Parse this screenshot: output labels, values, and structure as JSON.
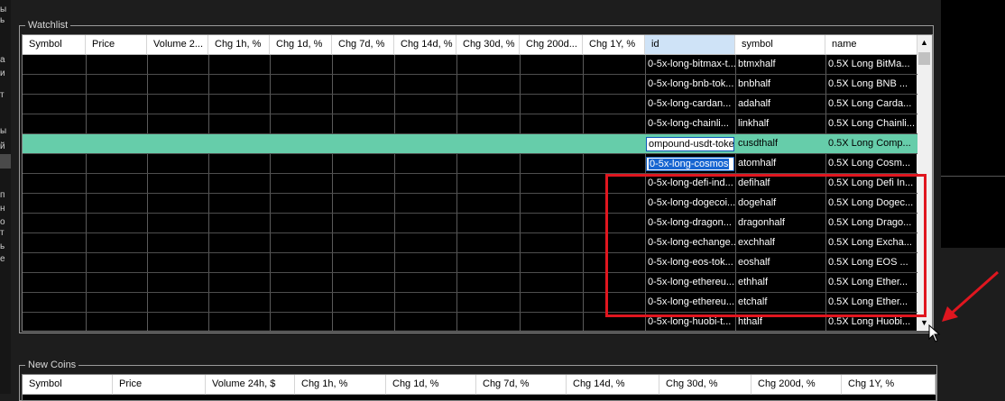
{
  "left_strip": [
    "ы",
    "ь",
    "а",
    "и",
    "т",
    "ы",
    "й",
    "п",
    "н",
    "о",
    "т",
    "ь",
    "е"
  ],
  "watchlist": {
    "title": "Watchlist",
    "columns": [
      "Symbol",
      "Price",
      "Volume 2...",
      "Chg 1h, %",
      "Chg 1d, %",
      "Chg 7d, %",
      "Chg 14d, %",
      "Chg 30d, %",
      "Chg 200d...",
      "Chg 1Y, %",
      "id",
      "symbol",
      "name"
    ],
    "rows": [
      {
        "id": "0-5x-long-bitmax-t...",
        "symbol": "btmxhalf",
        "name": "0.5X Long BitMa..."
      },
      {
        "id": "0-5x-long-bnb-tok...",
        "symbol": "bnbhalf",
        "name": "0.5X Long BNB ..."
      },
      {
        "id": "0-5x-long-cardan...",
        "symbol": "adahalf",
        "name": "0.5X Long Carda..."
      },
      {
        "id": "0-5x-long-chainli...",
        "symbol": "linkhalf",
        "name": "0.5X Long Chainli..."
      },
      {
        "id_edit": "ompound-usdt-token",
        "symbol": "cusdthalf",
        "name": "0.5X Long Comp...",
        "selected": true
      },
      {
        "id_edit_hl": "0-5x-long-cosmos",
        "symbol": "atomhalf",
        "name": "0.5X Long Cosm..."
      },
      {
        "id": "0-5x-long-defi-ind...",
        "symbol": "defihalf",
        "name": "0.5X Long Defi In..."
      },
      {
        "id": "0-5x-long-dogecoi...",
        "symbol": "dogehalf",
        "name": "0.5X Long Dogec..."
      },
      {
        "id": "0-5x-long-dragon...",
        "symbol": "dragonhalf",
        "name": "0.5X Long Drago..."
      },
      {
        "id": "0-5x-long-echange...",
        "symbol": "exchhalf",
        "name": "0.5X Long Excha..."
      },
      {
        "id": "0-5x-long-eos-tok...",
        "symbol": "eoshalf",
        "name": "0.5X Long EOS ..."
      },
      {
        "id": "0-5x-long-ethereu...",
        "symbol": "ethhalf",
        "name": "0.5X Long Ether..."
      },
      {
        "id": "0-5x-long-ethereu...",
        "symbol": "etchalf",
        "name": "0.5X Long Ether..."
      },
      {
        "id": "0-5x-long-huobi-t...",
        "symbol": "hthalf",
        "name": "0.5X Long Huobi..."
      }
    ]
  },
  "new_coins": {
    "title": "New Coins",
    "columns": [
      "Symbol",
      "Price",
      "Volume 24h, $",
      "Chg 1h, %",
      "Chg 1d, %",
      "Chg 7d, %",
      "Chg 14d, %",
      "Chg 30d, %",
      "Chg 200d, %",
      "Chg 1Y, %"
    ]
  },
  "colors": {
    "selected_row": "#66cdaa",
    "annotation": "#e0161f"
  }
}
